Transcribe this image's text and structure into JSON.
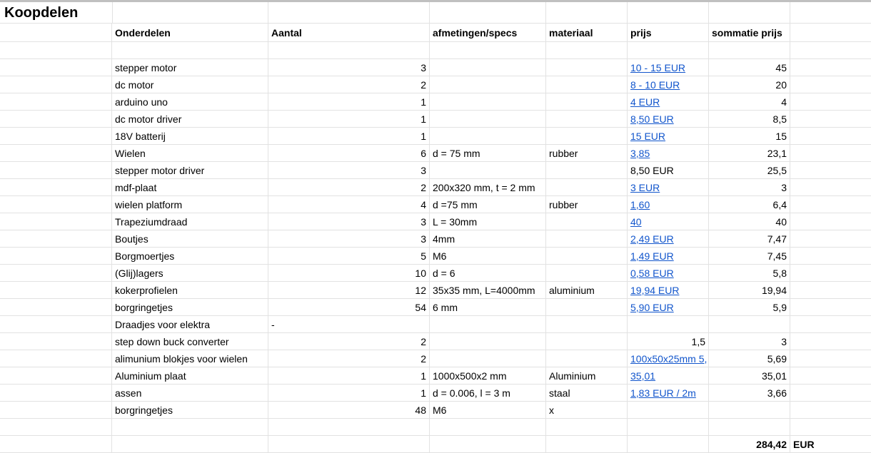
{
  "sheet": {
    "title": "Koopdelen",
    "headers": [
      "Onderdelen",
      "Aantal",
      "afmetingen/specs",
      "materiaal",
      "prijs",
      "sommatie prijs"
    ],
    "rows": [
      {
        "name": "stepper  motor",
        "qty": "3",
        "specs": "",
        "material": "",
        "price": "10 - 15 EUR",
        "price_link": true,
        "sum": "45"
      },
      {
        "name": "dc motor",
        "qty": "2",
        "specs": "",
        "material": "",
        "price": "8 - 10 EUR",
        "price_link": true,
        "sum": "20"
      },
      {
        "name": "arduino uno",
        "qty": "1",
        "specs": "",
        "material": "",
        "price": "4 EUR",
        "price_link": true,
        "sum": "4"
      },
      {
        "name": "dc motor driver",
        "qty": "1",
        "specs": "",
        "material": "",
        "price": "8,50 EUR",
        "price_link": true,
        "sum": "8,5"
      },
      {
        "name": "18V batterij",
        "qty": "1",
        "specs": "",
        "material": "",
        "price": "15 EUR",
        "price_link": true,
        "sum": "15"
      },
      {
        "name": "Wielen",
        "qty": "6",
        "specs": "d = 75 mm",
        "material": "rubber",
        "price": "3,85",
        "price_link": true,
        "sum": "23,1"
      },
      {
        "name": "stepper motor driver",
        "qty": "3",
        "specs": "",
        "material": "",
        "price": "8,50 EUR",
        "price_link": false,
        "sum": "25,5"
      },
      {
        "name": "mdf-plaat",
        "qty": "2",
        "specs": "200x320 mm, t = 2 mm",
        "material": "",
        "price": "3 EUR ",
        "price_link": true,
        "sum": "3"
      },
      {
        "name": "wielen platform",
        "qty": "4",
        "specs": "d =75 mm",
        "material": "rubber",
        "price": "1,60",
        "price_link": true,
        "sum": "6,4"
      },
      {
        "name": "Trapeziumdraad",
        "qty": "3",
        "specs": "L = 30mm",
        "material": "",
        "price": "40",
        "price_link": true,
        "sum": "40"
      },
      {
        "name": "Boutjes",
        "qty": "3",
        "specs": "4mm",
        "material": "",
        "price": "2,49 EUR",
        "price_link": true,
        "sum": "7,47"
      },
      {
        "name": "Borgmoertjes",
        "qty": "5",
        "specs": "M6",
        "material": "",
        "price": "1,49 EUR",
        "price_link": true,
        "sum": "7,45"
      },
      {
        "name": "(Glij)lagers",
        "qty": "10",
        "specs": "d = 6",
        "material": "",
        "price": "0,58 EUR",
        "price_link": true,
        "sum": "5,8"
      },
      {
        "name": "kokerprofielen",
        "qty": "12",
        "specs": "35x35 mm, L=4000mm",
        "material": "aluminium",
        "price": "19,94 EUR",
        "price_link": true,
        "sum": "19,94"
      },
      {
        "name": "borgringetjes",
        "qty": "54",
        "specs": "6 mm",
        "material": "",
        "price": "5,90 EUR",
        "price_link": true,
        "sum": "5,9"
      },
      {
        "name": "Draadjes voor elektra",
        "qty": "-",
        "qty_left": true,
        "specs": "",
        "material": "",
        "price": "",
        "price_link": false,
        "sum": ""
      },
      {
        "name": "step down buck converter",
        "qty": "2",
        "specs": "",
        "material": "",
        "price": "1,5",
        "price_link": false,
        "price_right": true,
        "sum": "3"
      },
      {
        "name": "alimunium blokjes voor wielen",
        "qty": "2",
        "specs": "",
        "material": "",
        "price": "100x50x25mm 5,",
        "price_link": true,
        "sum": "5,69"
      },
      {
        "name": "Aluminium plaat",
        "qty": "1",
        "specs": "1000x500x2 mm",
        "material": "Aluminium",
        "price": "35,01",
        "price_link": true,
        "sum": "35,01"
      },
      {
        "name": "assen",
        "qty": "1",
        "specs": "d = 0.006, l = 3 m",
        "material": "staal",
        "price": "1,83 EUR / 2m",
        "price_link": true,
        "sum": "3,66"
      },
      {
        "name": "borgringetjes",
        "qty": "48",
        "specs": "M6",
        "material": "x",
        "price": "",
        "price_link": false,
        "sum": ""
      }
    ],
    "total": {
      "value": "284,42",
      "currency": "EUR"
    },
    "colors": {
      "link": "#1155cc",
      "grid": "#e2e2e2"
    }
  }
}
